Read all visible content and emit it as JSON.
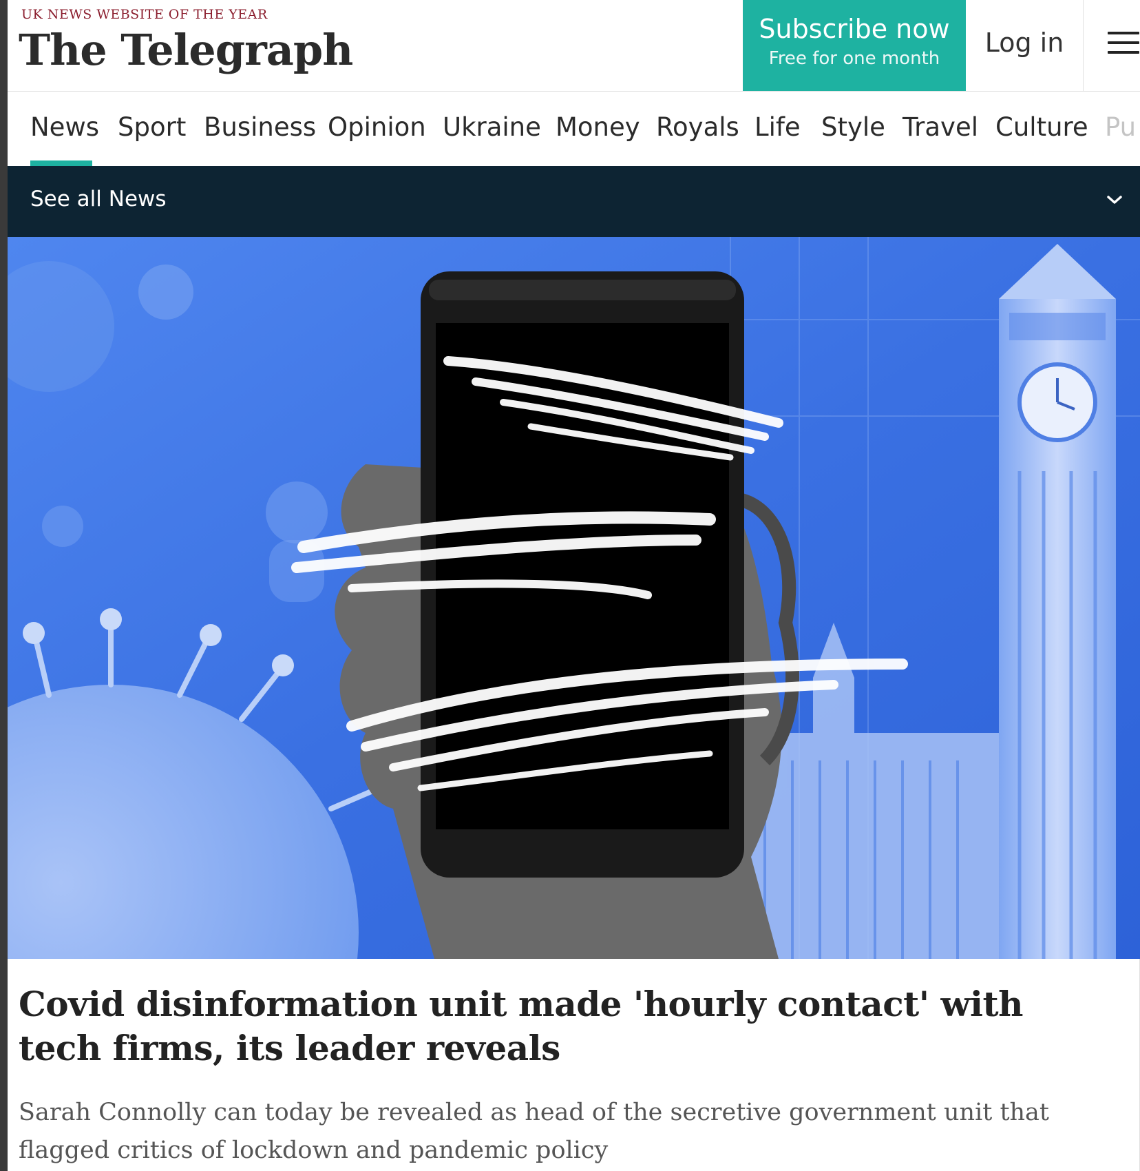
{
  "header": {
    "tagline": "UK NEWS WEBSITE OF THE YEAR",
    "logo_text": "The Telegraph",
    "subscribe_label": "Subscribe now",
    "subscribe_sublabel": "Free for one month",
    "login_label": "Log in",
    "menu_icon": "hamburger-icon"
  },
  "nav": {
    "items": [
      {
        "label": "News",
        "active": true
      },
      {
        "label": "Sport"
      },
      {
        "label": "Business"
      },
      {
        "label": "Opinion"
      },
      {
        "label": "Ukraine"
      },
      {
        "label": "Money"
      },
      {
        "label": "Royals"
      },
      {
        "label": "Life"
      },
      {
        "label": "Style"
      },
      {
        "label": "Travel"
      },
      {
        "label": "Culture"
      },
      {
        "label": "Pu"
      }
    ],
    "accent_color": "#1eb2a1"
  },
  "section_bar": {
    "label": "See all News",
    "icon": "chevron-down-icon",
    "background": "#0d2433"
  },
  "article": {
    "headline": "Covid disinformation unit made 'hourly contact' with tech firms, its leader reveals",
    "standfirst": "Sarah Connolly can today be revealed as head of the secretive government unit that flagged critics of lockdown and pandemic policy"
  }
}
